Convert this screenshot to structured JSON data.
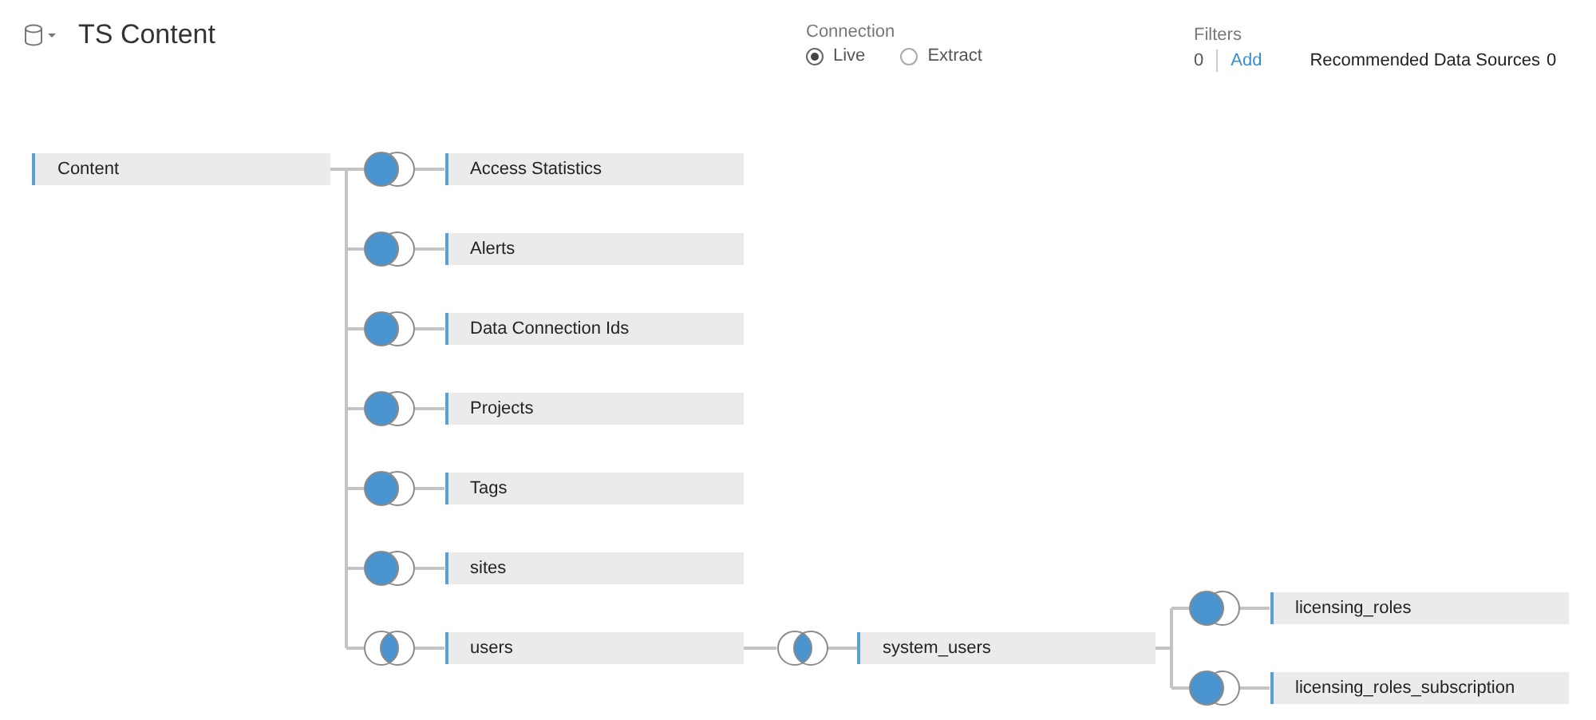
{
  "data_source": {
    "title": "TS Content"
  },
  "connection": {
    "label": "Connection",
    "options": [
      {
        "label": "Live",
        "selected": true
      },
      {
        "label": "Extract",
        "selected": false
      }
    ]
  },
  "filters": {
    "label": "Filters",
    "count": "0",
    "action": "Add"
  },
  "recommended": {
    "label": "Recommended Data Sources",
    "count": "0"
  },
  "join_tree": {
    "table": "Content",
    "children": [
      {
        "join": {
          "kind": "left"
        },
        "table": "Access Statistics"
      },
      {
        "join": {
          "kind": "left"
        },
        "table": "Alerts"
      },
      {
        "join": {
          "kind": "left"
        },
        "table": "Data Connection Ids"
      },
      {
        "join": {
          "kind": "left"
        },
        "table": "Projects"
      },
      {
        "join": {
          "kind": "left"
        },
        "table": "Tags"
      },
      {
        "join": {
          "kind": "left"
        },
        "table": "sites"
      },
      {
        "join": {
          "kind": "inner"
        },
        "table": "users",
        "children": [
          {
            "join": {
              "kind": "inner"
            },
            "table": "system_users",
            "children": [
              {
                "join": {
                  "kind": "left"
                },
                "table": "licensing_roles"
              },
              {
                "join": {
                  "kind": "left"
                },
                "table": "licensing_roles_subscription"
              }
            ]
          }
        ]
      }
    ]
  }
}
